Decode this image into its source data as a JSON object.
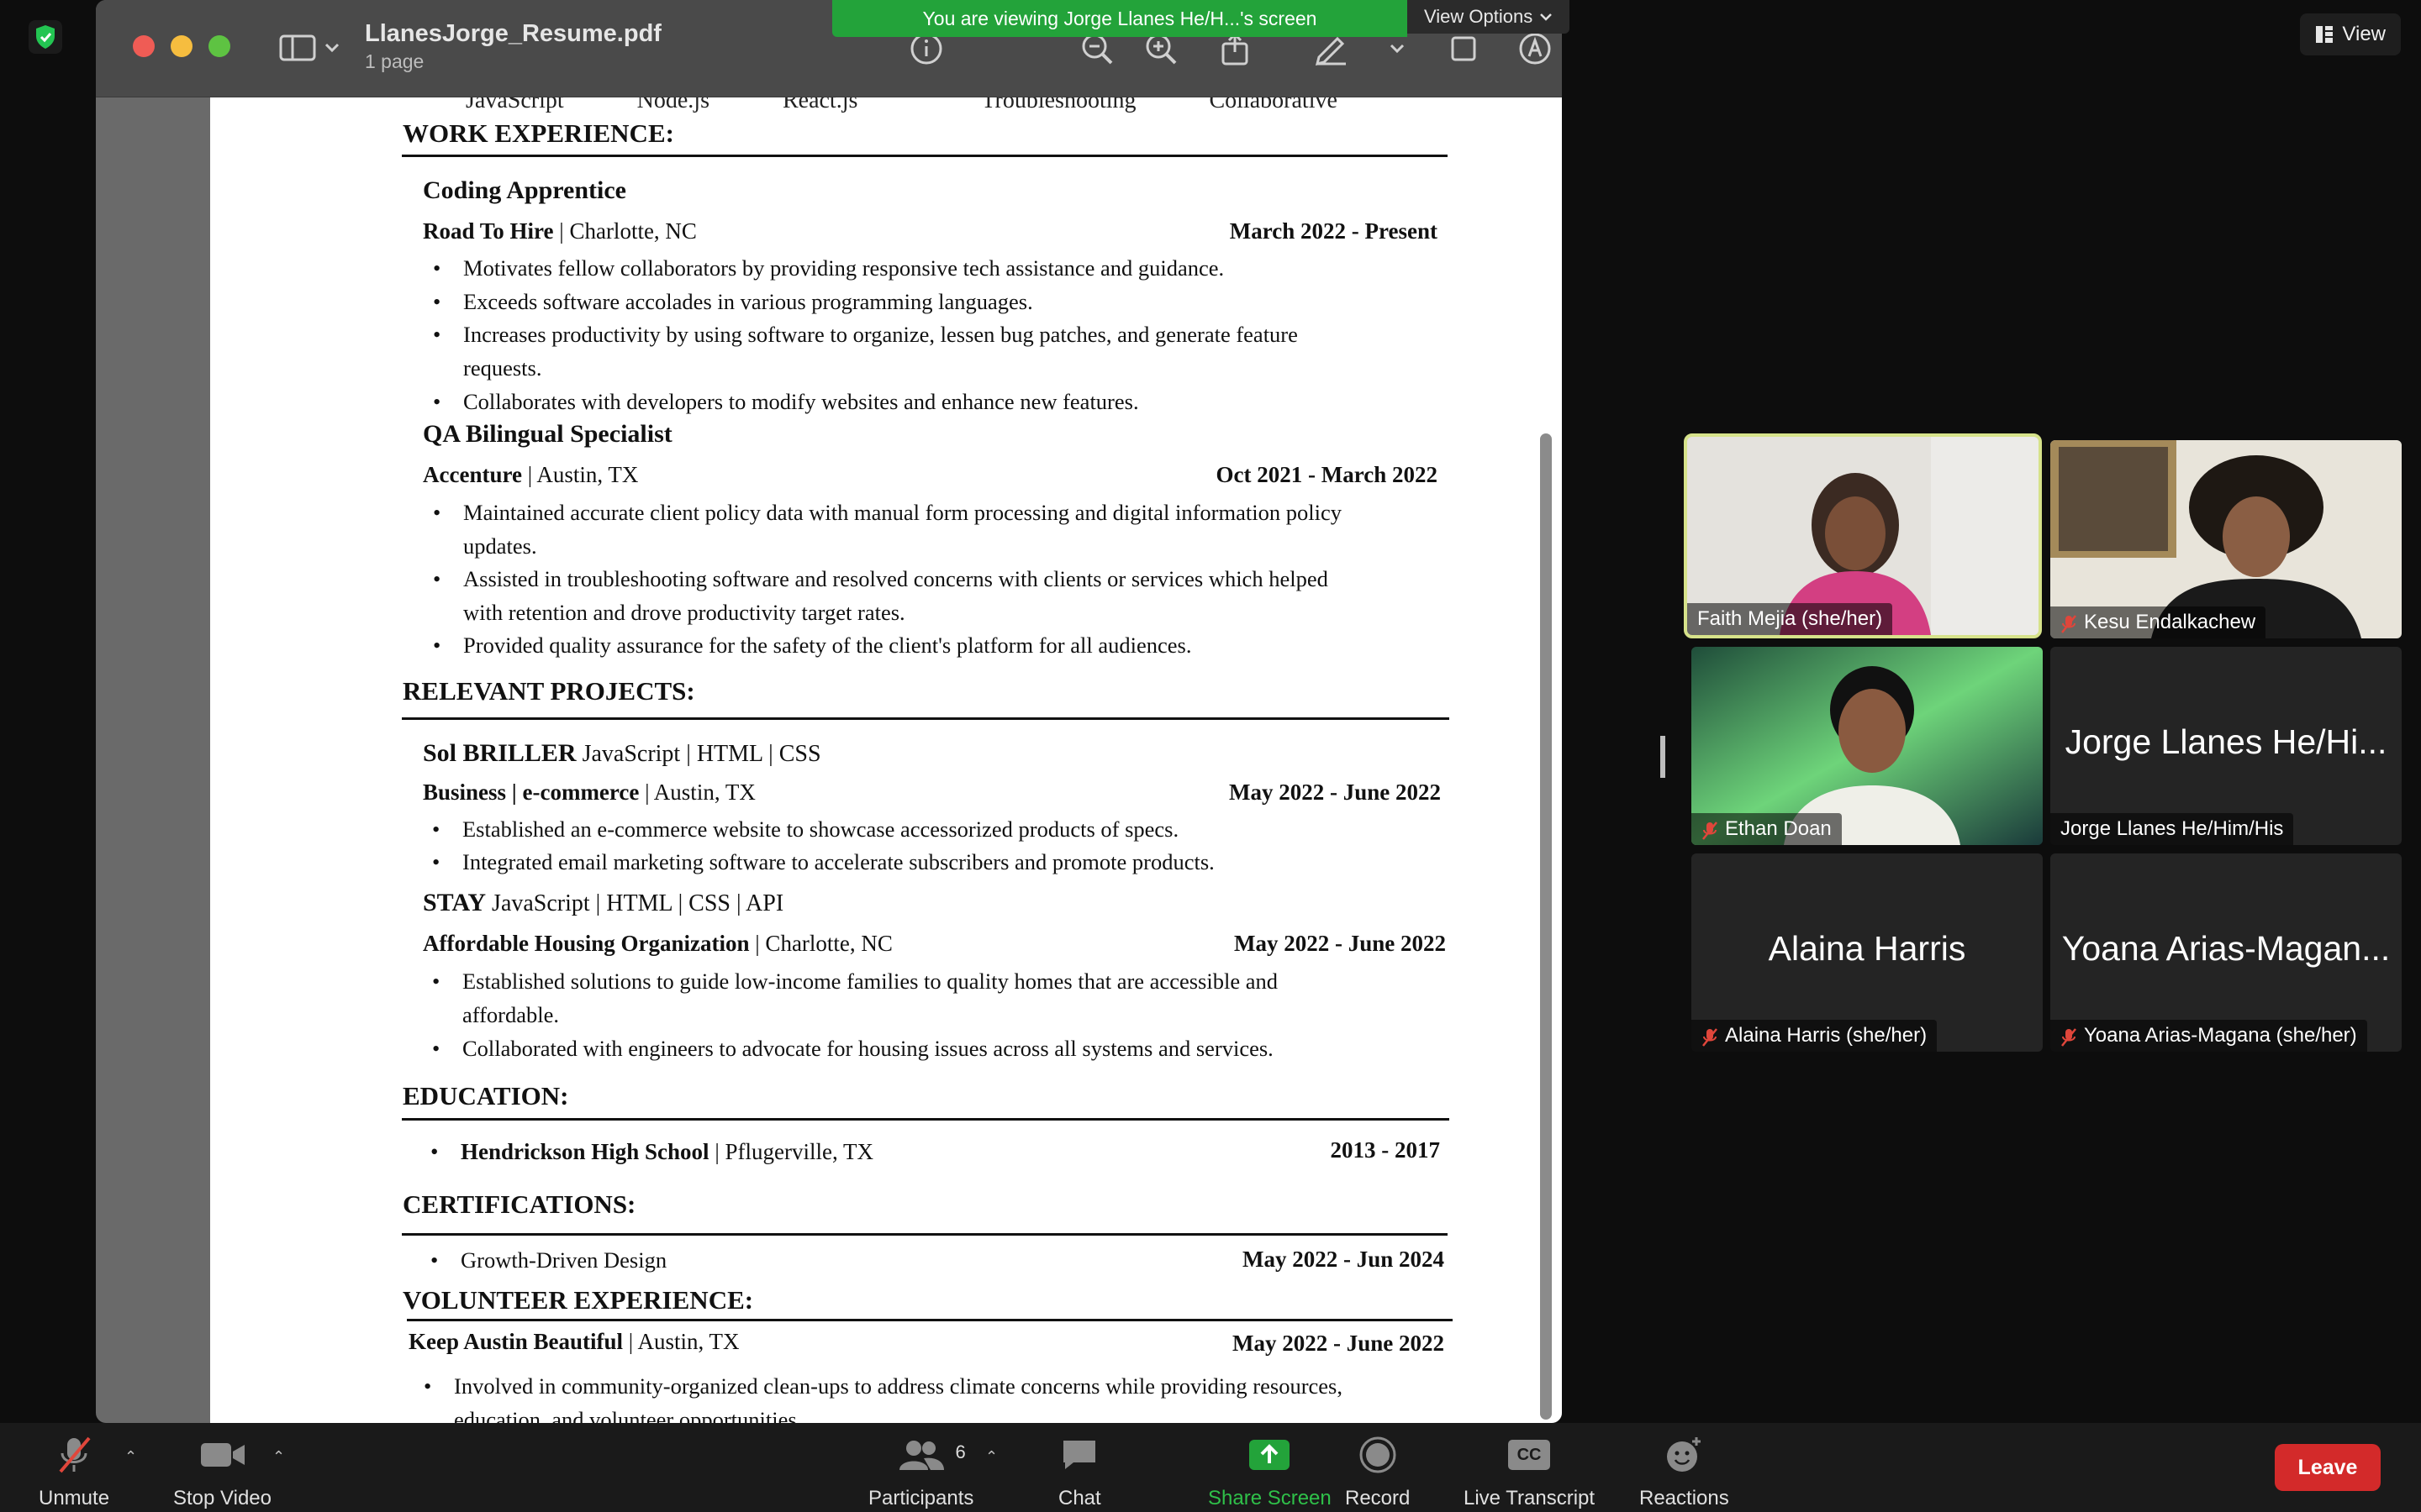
{
  "colors": {
    "share_green": "#23a33a",
    "leave_red": "#d32a2a",
    "active_speaker": "#d6e28a",
    "muted_red": "#e0463b"
  },
  "banner": {
    "message": "You are viewing Jorge Llanes He/H...'s screen",
    "view_options": "View Options"
  },
  "view_button": {
    "label": "View"
  },
  "preview": {
    "title": "LlanesJorge_Resume.pdf",
    "subtitle": "1 page",
    "toolbar_icons": [
      "info-icon",
      "zoom-out-icon",
      "zoom-in-icon",
      "share-icon",
      "markup-pen-icon",
      "chevron-down-icon",
      "crop-icon",
      "annotate-icon",
      "search-icon"
    ]
  },
  "resume": {
    "cutoff_line": [
      "JavaScript",
      "Node.js",
      "React.js",
      "Troubleshooting",
      "Collaborative"
    ],
    "work": {
      "heading": "WORK EXPERIENCE:",
      "jobs": [
        {
          "title": "Coding Apprentice",
          "org": "Road To Hire",
          "loc": " | Charlotte, NC",
          "dates": "March 2022 - Present",
          "bullets": [
            "Motivates fellow collaborators by providing responsive tech assistance and guidance.",
            "Exceeds software accolades in various programming languages.",
            "Increases productivity by using software to organize, lessen bug patches, and generate feature",
            "requests.",
            "Collaborates with developers to modify websites and enhance new features."
          ]
        },
        {
          "title": "QA Bilingual Specialist",
          "org": "Accenture",
          "loc": " | Austin, TX",
          "dates": "Oct 2021 - March 2022",
          "bullets": [
            "Maintained accurate client policy data with manual form processing and digital information policy",
            "updates.",
            "Assisted in troubleshooting software and resolved concerns with clients or services which helped",
            "with retention and drove productivity target rates.",
            "Provided quality assurance for the safety of the client's platform for all audiences."
          ]
        }
      ]
    },
    "projects": {
      "heading": "RELEVANT PROJECTS:",
      "items": [
        {
          "name": "Sol BRILLER",
          "stack": " JavaScript | HTML | CSS",
          "org": "Business | e-commerce",
          "loc": " | Austin, TX",
          "dates": "May 2022 - June 2022",
          "bullets": [
            "Established an e-commerce website to showcase accessorized products of specs.",
            "Integrated email marketing software to accelerate subscribers and promote products."
          ]
        },
        {
          "name": "STAY",
          "stack": " JavaScript | HTML | CSS | API",
          "org": "Affordable Housing Organization",
          "loc": " | Charlotte, NC",
          "dates": "May 2022 - June 2022",
          "bullets": [
            "Established solutions to guide low-income families to quality homes that are accessible and",
            "affordable.",
            "Collaborated with engineers to advocate for housing issues across all systems and services."
          ]
        }
      ]
    },
    "education": {
      "heading": "EDUCATION:",
      "school": "Hendrickson High School",
      "loc": " | Pflugerville, TX",
      "dates": "2013 - 2017"
    },
    "certifications": {
      "heading": "CERTIFICATIONS:",
      "item": "Growth-Driven Design",
      "dates": "May 2022 - Jun 2024"
    },
    "volunteer": {
      "heading": "VOLUNTEER EXPERIENCE:",
      "org": "Keep Austin Beautiful",
      "loc": " | Austin, TX",
      "dates": "May 2022 -  June 2022",
      "bullet1": "Involved in community-organized clean-ups to address climate concerns while providing resources,",
      "bullet2": "education, and volunteer opportunities."
    }
  },
  "participants": [
    {
      "name": "Faith Mejia  (she/her)",
      "muted": false,
      "active": true,
      "video": true
    },
    {
      "name": "Kesu Endalkachew",
      "muted": true,
      "active": false,
      "video": true
    },
    {
      "name": "Ethan Doan",
      "muted": true,
      "active": false,
      "video": true
    },
    {
      "name": "Jorge Llanes He/Him/His",
      "display": "Jorge Llanes He/Hi...",
      "muted": false,
      "active": false,
      "video": false
    },
    {
      "name": "Alaina Harris  (she/her)",
      "display": "Alaina Harris",
      "muted": true,
      "active": false,
      "video": false
    },
    {
      "name": "Yoana Arias-Magana (she/her)",
      "display": "Yoana Arias-Magan...",
      "muted": true,
      "active": false,
      "video": false
    }
  ],
  "toolbar": {
    "unmute": "Unmute",
    "stop_video": "Stop Video",
    "participants": "Participants",
    "participants_count": "6",
    "chat": "Chat",
    "share_screen": "Share Screen",
    "record": "Record",
    "live_transcript": "Live Transcript",
    "cc": "CC",
    "reactions": "Reactions",
    "leave": "Leave"
  }
}
